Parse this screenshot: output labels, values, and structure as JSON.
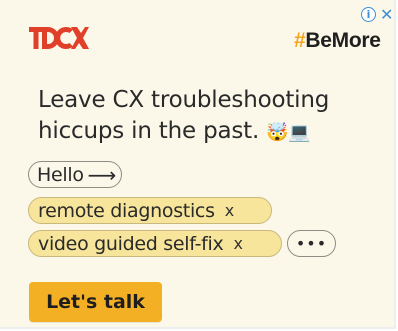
{
  "ad": {
    "brand_logo_text": "TDCX",
    "tagline_hash": "#",
    "tagline_word": "BeMore",
    "headline_line1": "Leave CX troubleshooting",
    "headline_line2": "hiccups in the past.",
    "headline_emoji": "🤯💻",
    "chips": {
      "hello": "Hello",
      "hello_arrow": "⟶",
      "remote": "remote diagnostics",
      "video": "video guided self-fix",
      "remove_glyph": "x",
      "more": "•••"
    },
    "cta_label": "Let's talk"
  },
  "adchoices": {
    "info_glyph": "i",
    "close_glyph": "✕"
  },
  "colors": {
    "background": "#fbf7e9",
    "brand_red": "#e0402a",
    "accent_orange": "#f4a51c",
    "chip_selected": "#f6e59a",
    "cta": "#f4b025",
    "adchoices_blue": "#3d8fd6"
  },
  "icons": [
    "info-icon",
    "close-icon",
    "arrow-right-icon",
    "remove-icon",
    "more-icon"
  ]
}
